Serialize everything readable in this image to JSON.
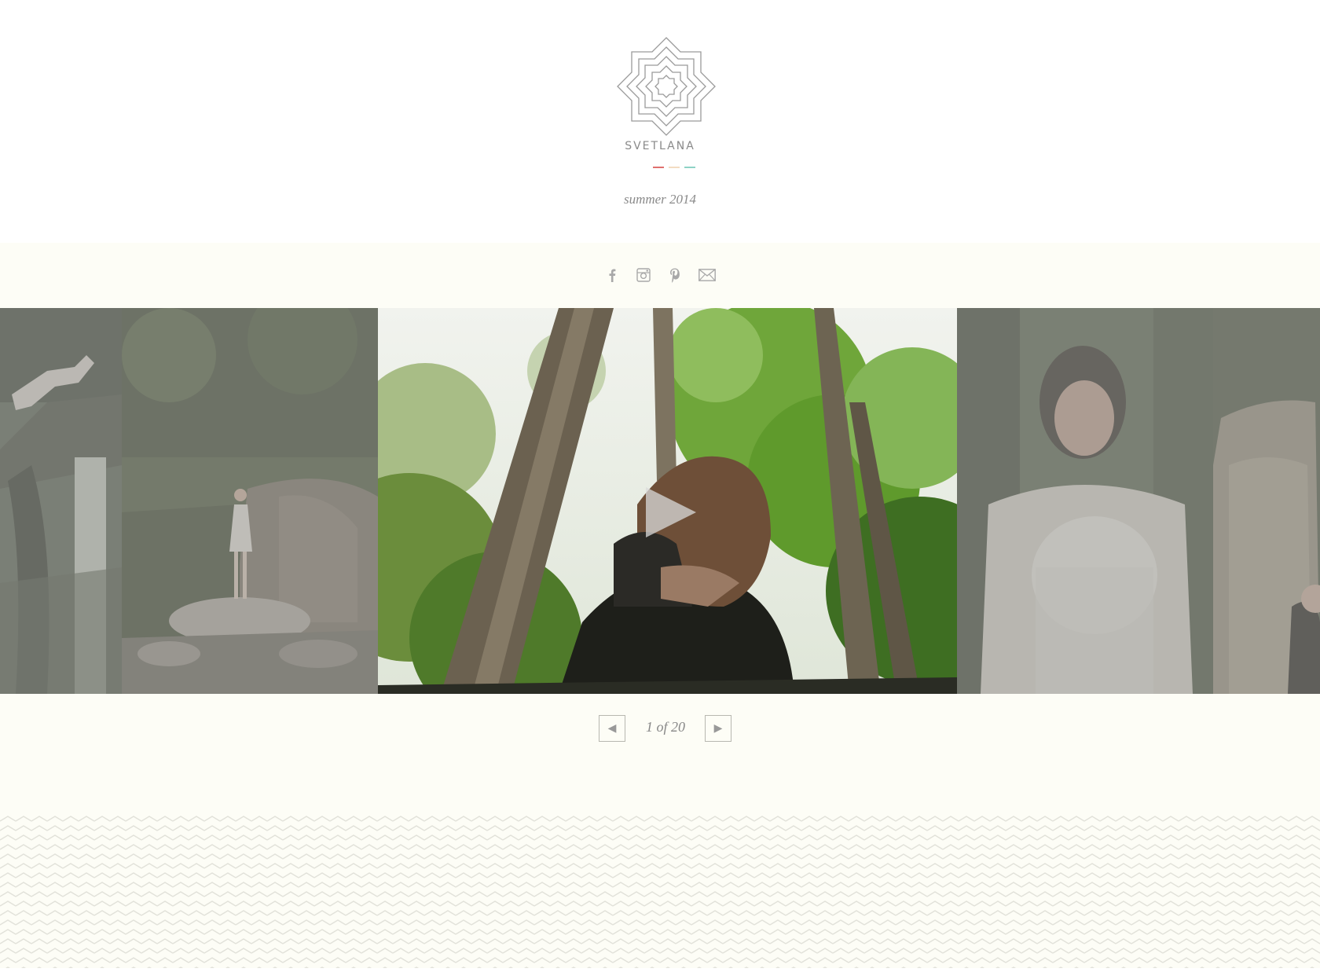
{
  "brand": {
    "name": "SVETLANA",
    "tagline": "summer 2014",
    "divider_colors": [
      "#e0706e",
      "#f3dcc2",
      "#8ed3c6"
    ]
  },
  "social": [
    {
      "icon": "facebook-icon",
      "label": "f"
    },
    {
      "icon": "instagram-icon"
    },
    {
      "icon": "pinterest-icon"
    },
    {
      "icon": "mail-icon"
    }
  ],
  "gallery": {
    "slides": [
      {
        "name": "slide-climber",
        "active": false
      },
      {
        "name": "slide-rock-standing",
        "active": false
      },
      {
        "name": "slide-forest-video",
        "active": true
      },
      {
        "name": "slide-woman-knit",
        "active": false
      },
      {
        "name": "slide-stone",
        "active": false
      }
    ],
    "play_icon": "play-icon"
  },
  "pager": {
    "prev_label": "◀",
    "next_label": "▶",
    "count": "1 of 20"
  },
  "colors": {
    "band": "#fdfdf6",
    "zigzag_line": "#e4e4dc",
    "icon_gray": "#a8a8a8"
  }
}
